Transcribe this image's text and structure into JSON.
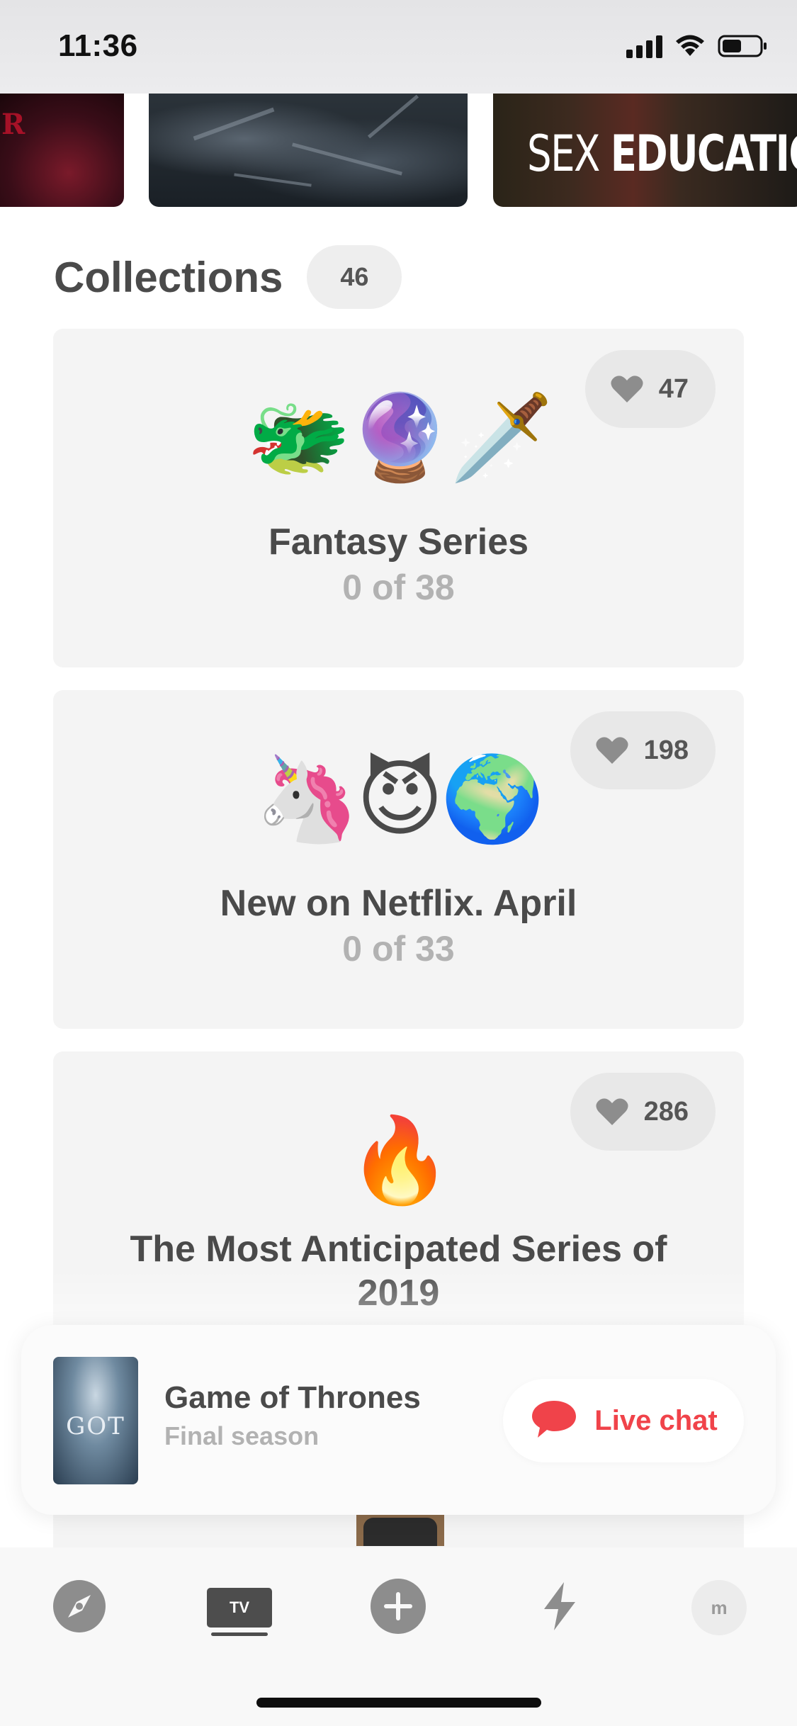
{
  "status_bar": {
    "time": "11:36"
  },
  "carousel": {
    "posters": [
      {
        "name": "Stranger Things",
        "visible_text": "R"
      },
      {
        "name": "war-poster",
        "visible_text": ""
      },
      {
        "name": "Sex Education",
        "title_light": "SEX",
        "title_bold": "EDUCATION"
      }
    ]
  },
  "collections": {
    "title": "Collections",
    "count": "46",
    "items": [
      {
        "emoji": "🐲🔮🗡️",
        "title": "Fantasy Series",
        "progress": "0 of 38",
        "likes": "47"
      },
      {
        "emoji": "🦄😈🌍",
        "title": "New on Netflix. April",
        "progress": "0 of 33",
        "likes": "198"
      },
      {
        "emoji": "🔥",
        "title": "The Most Anticipated Series of 2019",
        "progress": "",
        "likes": "286"
      }
    ]
  },
  "mini_player": {
    "thumb_text": "GOT",
    "title": "Game of Thrones",
    "subtitle": "Final season",
    "live_chat_label": "Live chat"
  },
  "tab_bar": {
    "tv_label": "TV",
    "profile_initial": "m",
    "icons": [
      "discover-icon",
      "tv-icon",
      "add-icon",
      "activity-icon",
      "profile-avatar"
    ]
  },
  "colors": {
    "accent_red": "#f0434a",
    "card_bg": "#f4f4f4",
    "text_dark": "#4a4a4a",
    "text_muted": "#b2b2b2"
  }
}
